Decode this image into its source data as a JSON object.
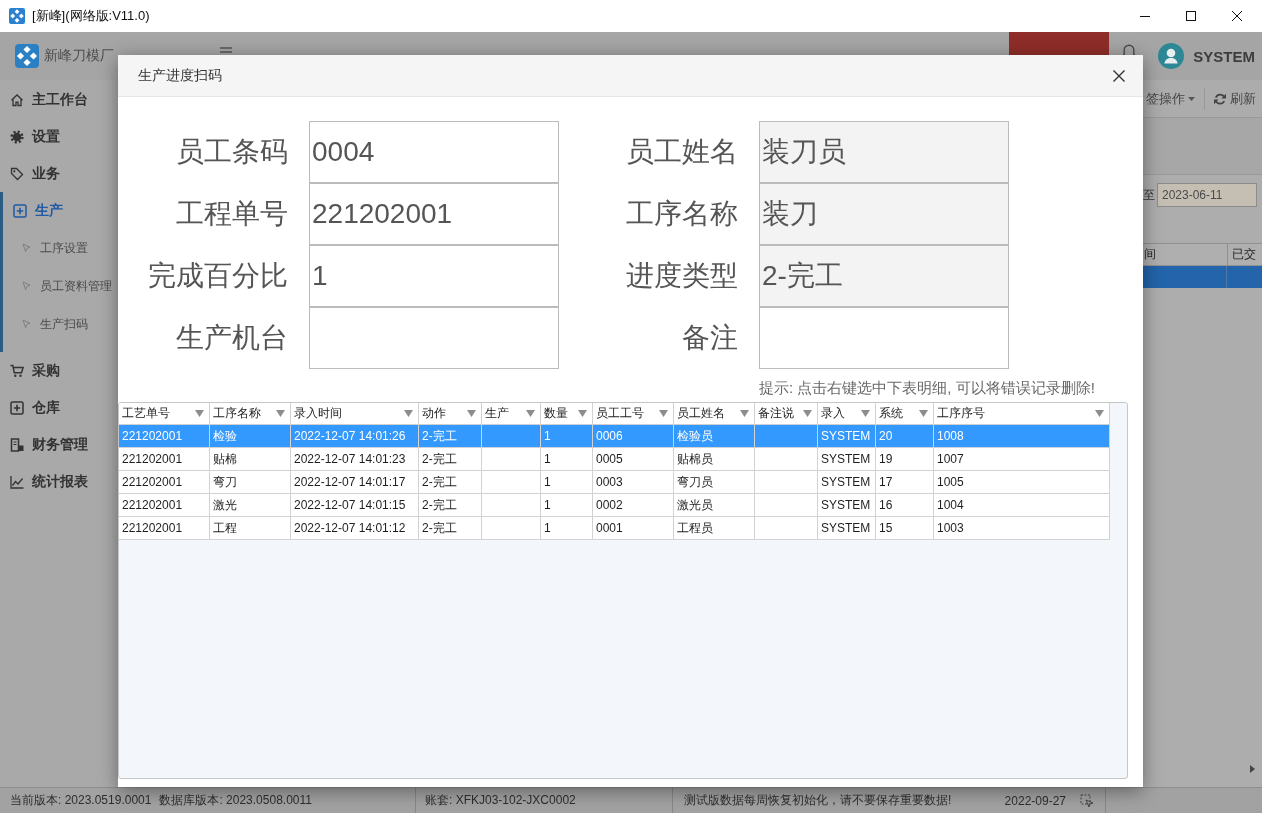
{
  "window": {
    "title": "[新峰](网络版:V11.0)"
  },
  "header": {
    "app_name": "新峰刀模厂",
    "user": "SYSTEM"
  },
  "sidebar": {
    "items": [
      {
        "label": "主工作台",
        "selected": false
      },
      {
        "label": "设置",
        "selected": false
      },
      {
        "label": "业务",
        "selected": false
      },
      {
        "label": "生产",
        "selected": true,
        "children": [
          {
            "label": "工序设置",
            "selected": false
          },
          {
            "label": "员工资料管理",
            "selected": false
          },
          {
            "label": "生产扫码",
            "selected": false
          }
        ]
      },
      {
        "label": "采购",
        "selected": false
      },
      {
        "label": "仓库",
        "selected": false
      },
      {
        "label": "财务管理",
        "selected": false
      },
      {
        "label": "统计报表",
        "selected": false
      }
    ]
  },
  "toolbar": {
    "buttons": [
      {
        "kind": "dropdown",
        "label": "签操作"
      },
      {
        "kind": "button",
        "label": "刷新"
      }
    ]
  },
  "date_filter": {
    "label": "至",
    "value": "2023-06-11"
  },
  "list": {
    "columns": [
      "间",
      "已交"
    ],
    "rows": [
      {
        "selected": true
      }
    ]
  },
  "dialog": {
    "title": "生产进度扫码",
    "fields": [
      {
        "label": "员工条码",
        "value": "0004",
        "readonly": false
      },
      {
        "label": "员工姓名",
        "value": "装刀员",
        "readonly": true
      },
      {
        "label": "工程单号",
        "value": "221202001",
        "readonly": false
      },
      {
        "label": "工序名称",
        "value": "装刀",
        "readonly": true
      },
      {
        "label": "完成百分比",
        "value": "1",
        "readonly": false
      },
      {
        "label": "进度类型",
        "value": "2-完工",
        "readonly": true
      },
      {
        "label": "生产机台",
        "readonly": false
      },
      {
        "label": "备注",
        "readonly": false
      }
    ],
    "hint": "提示: 点击右键选中下表明细, 可以将错误记录删除!",
    "grid": {
      "columns": [
        "工艺单号",
        "工序名称",
        "录入时间",
        "动作",
        "生产",
        "数量",
        "员工工号",
        "员工姓名",
        "备注说",
        "录入",
        "系统",
        "工序序号"
      ],
      "rows": [
        {
          "selected": true,
          "order_no": "221202001",
          "process_name": "检验",
          "entry_time": "2022-12-07 14:01:26",
          "action": "2-完工",
          "quantity": "1",
          "employee_no": "0006",
          "employee_name": "检验员",
          "entered_by": "SYSTEM",
          "system_no": "20",
          "process_seq": "1008"
        },
        {
          "selected": false,
          "order_no": "221202001",
          "process_name": "贴棉",
          "entry_time": "2022-12-07 14:01:23",
          "action": "2-完工",
          "quantity": "1",
          "employee_no": "0005",
          "employee_name": "贴棉员",
          "entered_by": "SYSTEM",
          "system_no": "19",
          "process_seq": "1007"
        },
        {
          "selected": false,
          "order_no": "221202001",
          "process_name": "弯刀",
          "entry_time": "2022-12-07 14:01:17",
          "action": "2-完工",
          "quantity": "1",
          "employee_no": "0003",
          "employee_name": "弯刀员",
          "entered_by": "SYSTEM",
          "system_no": "17",
          "process_seq": "1005"
        },
        {
          "selected": false,
          "order_no": "221202001",
          "process_name": "激光",
          "entry_time": "2022-12-07 14:01:15",
          "action": "2-完工",
          "quantity": "1",
          "employee_no": "0002",
          "employee_name": "激光员",
          "entered_by": "SYSTEM",
          "system_no": "16",
          "process_seq": "1004"
        },
        {
          "selected": false,
          "order_no": "221202001",
          "process_name": "工程",
          "entry_time": "2022-12-07 14:01:12",
          "action": "2-完工",
          "quantity": "1",
          "employee_no": "0001",
          "employee_name": "工程员",
          "entered_by": "SYSTEM",
          "system_no": "15",
          "process_seq": "1003"
        }
      ]
    }
  },
  "status_bar": {
    "sections": [
      [
        "当前版本: 2023.0519.0001",
        "数据库版本: 2023.0508.0011"
      ],
      [
        "账套: XFKJ03-102-JXC0002"
      ],
      [
        "测试版数据每周恢复初始化，请不要保存重要数据!",
        "2022-09-27"
      ]
    ]
  }
}
